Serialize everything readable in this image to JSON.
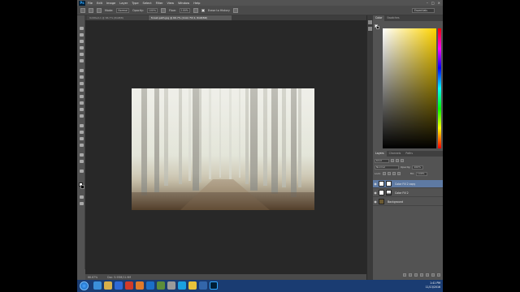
{
  "app": {
    "logo": "Ps",
    "menu": [
      "File",
      "Edit",
      "Image",
      "Layer",
      "Type",
      "Select",
      "Filter",
      "View",
      "Window",
      "Help"
    ]
  },
  "options": {
    "mode_label": "Mode:",
    "mode_value": "Normal",
    "opacity_label": "Opacity:",
    "opacity_value": "100%",
    "flow_label": "Flow:",
    "flow_value": "100%",
    "history_label": "Erase to History",
    "workspace": "Essentials"
  },
  "document": {
    "tabs": [
      {
        "label": "Untitled-1 @ 66.7% (RGB/8)",
        "active": false
      },
      {
        "label": "forest-path.jpg @ 66.7% (Color Fill 2, RGB/8#)",
        "active": true
      }
    ],
    "zoom": "66.67%",
    "doc_size": "Doc: 5.93M/11.9M"
  },
  "color_panel": {
    "tabs": [
      "Color",
      "Swatches"
    ],
    "fg_color": "#ffffff",
    "bg_color": "#000000",
    "picker_hue": "#ffd400"
  },
  "layers_panel": {
    "tabs": [
      "Layers",
      "Channels",
      "Paths"
    ],
    "kind_label": "Kind",
    "blend_mode": "Normal",
    "opacity_label": "Opacity:",
    "opacity_value": "100%",
    "lock_label": "Lock:",
    "fill_label": "Fill:",
    "fill_value": "100%",
    "layers": [
      {
        "name": "Color Fill 2 copy",
        "selected": true,
        "thumb_color": "#ffffff"
      },
      {
        "name": "Color Fill 2",
        "selected": false,
        "thumb_color": "#ffffff"
      },
      {
        "name": "Background",
        "selected": false,
        "thumb_color": "#6b5a33"
      }
    ]
  },
  "taskbar": {
    "time": "1:41 PM",
    "date": "11/13/2016"
  }
}
